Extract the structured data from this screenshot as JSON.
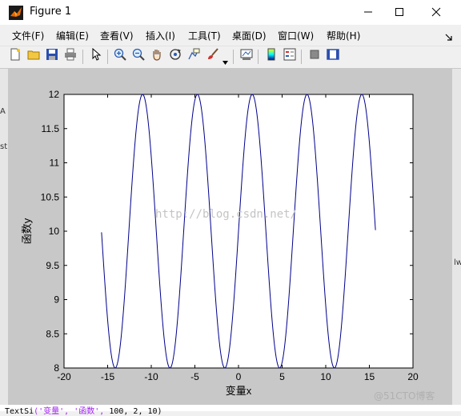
{
  "window": {
    "title": "Figure 1",
    "controls": [
      "minimize",
      "maximize",
      "close"
    ]
  },
  "menu": {
    "items": [
      "文件(F)",
      "编辑(E)",
      "查看(V)",
      "插入(I)",
      "工具(T)",
      "桌面(D)",
      "窗口(W)",
      "帮助(H)"
    ]
  },
  "toolbar": {
    "icons": [
      "new-figure-icon",
      "open-file-icon",
      "save-icon",
      "print-icon",
      "select-arrow-icon",
      "zoom-in-icon",
      "zoom-out-icon",
      "pan-hand-icon",
      "rotate-3d-icon",
      "data-cursor-icon",
      "brush-icon",
      "brush-dropdown-icon",
      "link-plot-icon",
      "colorbar-icon",
      "legend-icon",
      "hide-plot-tools-icon",
      "show-plot-tools-icon"
    ]
  },
  "background": {
    "code_line_prefix": "TextSi",
    "code_line_strings": "('变量', '函数',",
    "code_line_rest": "100, 2, 10)",
    "left_fragments": [
      "A",
      "st"
    ],
    "right_fragment": "lw"
  },
  "watermark": {
    "blog_url": "http://blog.csdn.net/",
    "corner": "@51CTO博客"
  },
  "chart_data": {
    "type": "line",
    "title": "",
    "xlabel": "变量x",
    "ylabel": "函数y",
    "xlim": [
      -20,
      20
    ],
    "ylim": [
      8,
      12
    ],
    "xticks": [
      -20,
      -15,
      -10,
      -5,
      0,
      5,
      10,
      15,
      20
    ],
    "yticks": [
      8,
      8.5,
      9,
      9.5,
      10,
      10.5,
      11,
      11.5,
      12
    ],
    "ytick_labels": [
      "8",
      "8.5",
      "9",
      "9.5",
      "10",
      "10.5",
      "11",
      "11.5",
      "12"
    ],
    "grid": false,
    "legend": false,
    "line_color": "#00008b",
    "function": "y = 10 + 2*sin(x)",
    "x_range": [
      -15.7,
      15.7
    ],
    "series": [
      {
        "x": [
          -15.7,
          -14.14,
          -10.99,
          -7.85,
          -4.71,
          -1.57,
          1.57,
          4.71,
          7.85,
          10.99,
          14.14,
          15.7
        ],
        "values": [
          10,
          8,
          12,
          8,
          12,
          8,
          12,
          8,
          12,
          8,
          12,
          10
        ]
      }
    ]
  }
}
